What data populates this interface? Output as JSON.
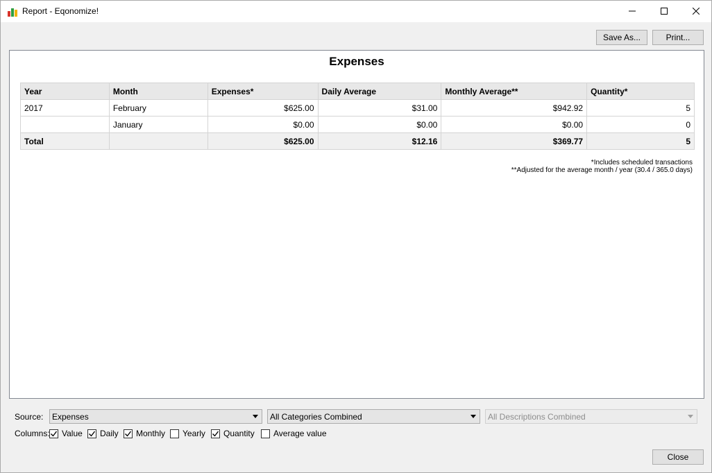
{
  "window": {
    "title": "Report - Eqonomize!"
  },
  "toolbar": {
    "save_as_label": "Save As...",
    "print_label": "Print..."
  },
  "report": {
    "title": "Expenses",
    "columns": [
      "Year",
      "Month",
      "Expenses*",
      "Daily Average",
      "Monthly Average**",
      "Quantity*"
    ],
    "rows": [
      {
        "year": "2017",
        "month": "February",
        "expenses": "$625.00",
        "daily": "$31.00",
        "monthly": "$942.92",
        "quantity": "5"
      },
      {
        "year": "",
        "month": "January",
        "expenses": "$0.00",
        "daily": "$0.00",
        "monthly": "$0.00",
        "quantity": "0"
      }
    ],
    "total": {
      "label": "Total",
      "month": "",
      "expenses": "$625.00",
      "daily": "$12.16",
      "monthly": "$369.77",
      "quantity": "5"
    },
    "footnote1": "*Includes scheduled transactions",
    "footnote2": "**Adjusted for the average month / year (30.4 / 365.0 days)"
  },
  "controls": {
    "source_label": "Source:",
    "source_value": "Expenses",
    "category_value": "All Categories Combined",
    "description_value": "All Descriptions Combined",
    "columns_label": "Columns:",
    "checkboxes": [
      {
        "label": "Value",
        "checked": true
      },
      {
        "label": "Daily",
        "checked": true
      },
      {
        "label": "Monthly",
        "checked": true
      },
      {
        "label": "Yearly",
        "checked": false
      },
      {
        "label": "Quantity",
        "checked": true
      },
      {
        "label": "Average value",
        "checked": false
      }
    ]
  },
  "footer": {
    "close_label": "Close"
  }
}
